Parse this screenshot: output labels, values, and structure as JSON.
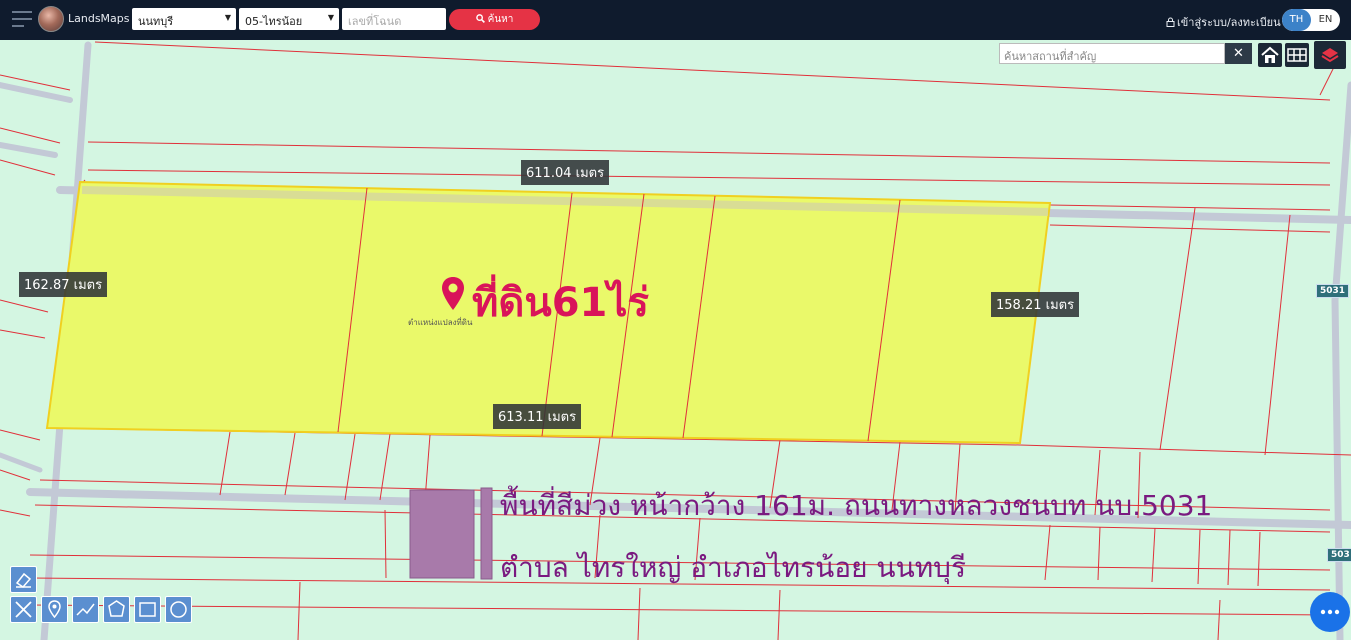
{
  "header": {
    "app_name": "LandsMaps",
    "province": "นนทบุรี",
    "district": "05-ไทรน้อย",
    "deed_placeholder": "เลขที่โฉนด",
    "search_label": "ค้นหา",
    "login_label": "เข้าสู่ระบบ/ลงทะเบียน",
    "lang_th": "TH",
    "lang_en": "EN"
  },
  "map": {
    "place_search_placeholder": "ค้นหาสถานที่สำคัญ",
    "clear_label": "✕",
    "plot_title": "ที่ดิน61ไร่",
    "plot_subtitle": "ตำแหน่งแปลงที่ดิน",
    "distances": {
      "top": "611.04 เมตร",
      "left": "162.87 เมตร",
      "right": "158.21 เมตร",
      "bottom": "613.11 เมตร"
    },
    "road_tags": [
      "5031",
      "503"
    ],
    "note_line1": "พื้นที่สีม่วง หน้ากว้าง 161ม. ถนนทางหลวงชนบท นบ.5031",
    "note_line2": "ตำบล ไทรใหญ่ อำเภอไทรน้อย นนทบุรี"
  },
  "colors": {
    "topbar": "#0f1b2d",
    "search_button": "#e53345",
    "map_bg": "#d4f6e2",
    "plot_fill": "#eaf96a",
    "boundary": "#e0303a",
    "road": "#c3c9d6",
    "purple_area": "#a87aaa",
    "title_color": "#d9145a",
    "note_color": "#7a1a80"
  },
  "icons": [
    "menu-icon",
    "search-icon",
    "lock-icon",
    "home-icon",
    "grid-icon",
    "layers-icon",
    "map-pin-icon",
    "eraser-icon",
    "ruler-icon",
    "marker-tool-icon",
    "polyline-tool-icon",
    "polygon-tool-icon",
    "rectangle-tool-icon",
    "circle-tool-icon",
    "more-icon"
  ]
}
